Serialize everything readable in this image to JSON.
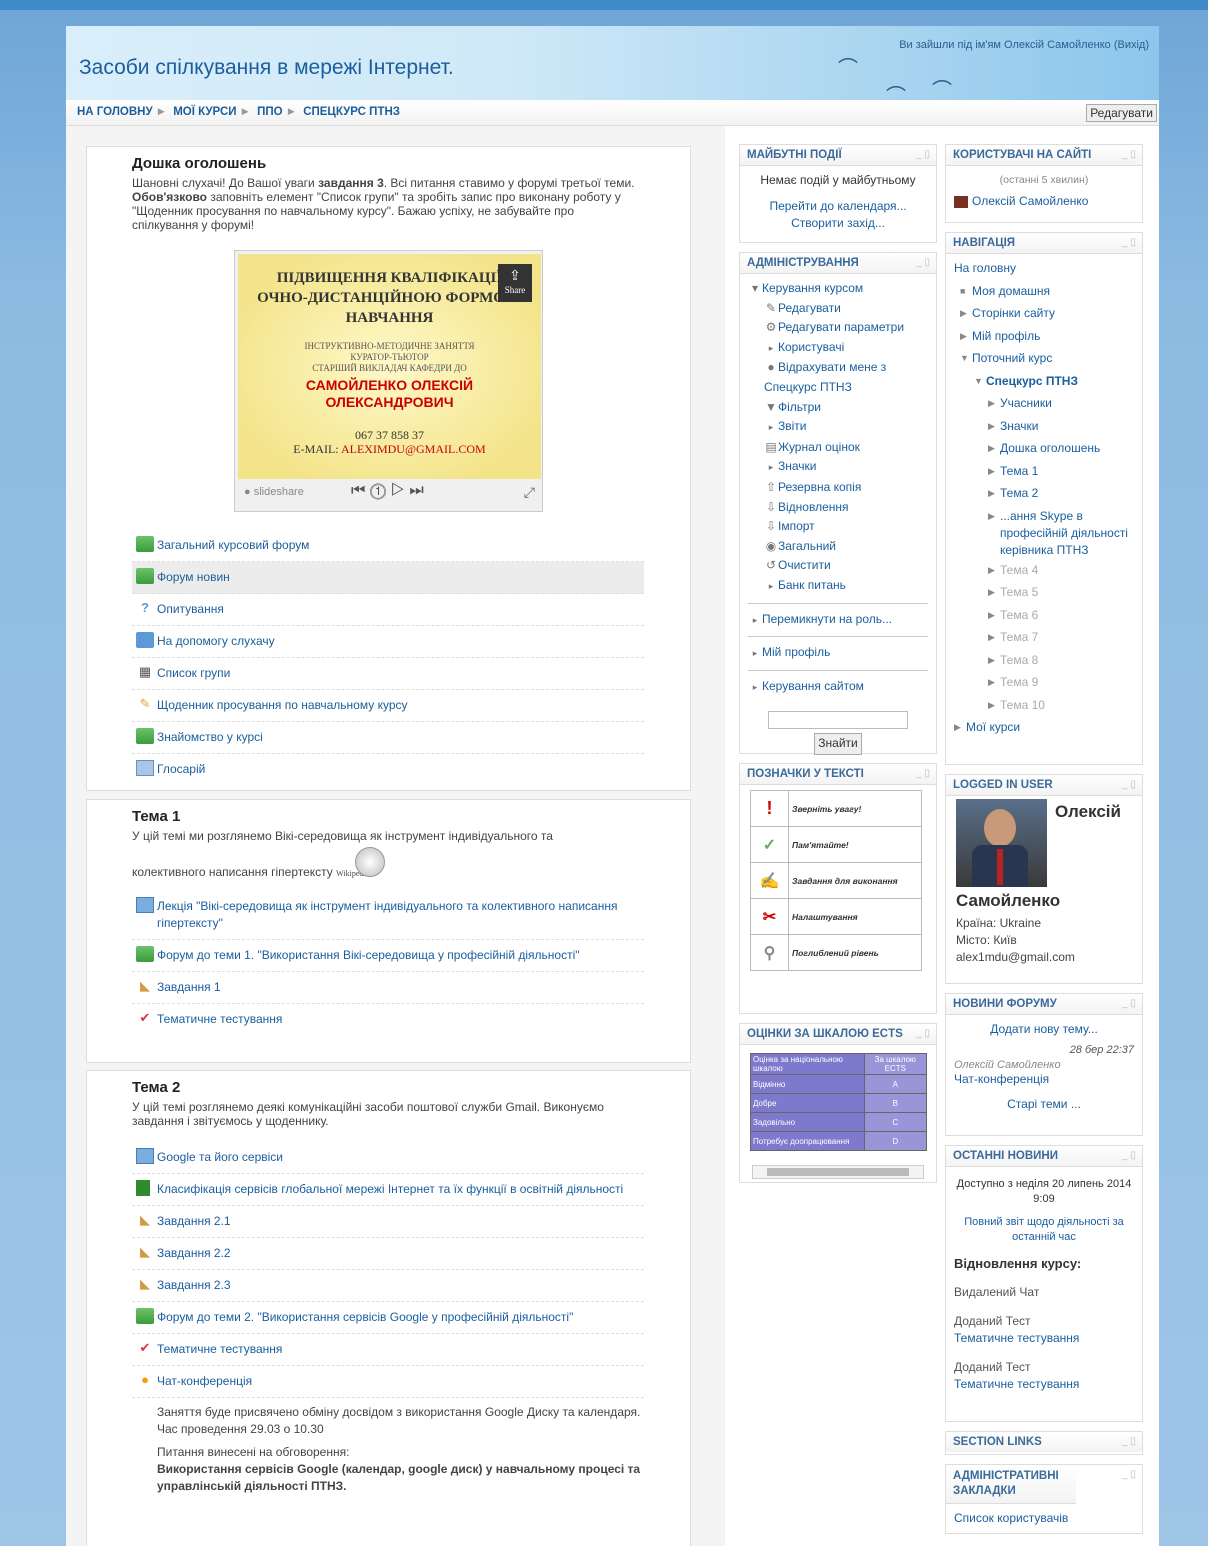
{
  "header": {
    "title": "Засоби спілкування в мережі Інтернет.",
    "login_text": "Ви зайшли під ім'ям Олексій Самойленко (Вихід)"
  },
  "breadcrumb": [
    "НА ГОЛОВНУ",
    "МОЇ КУРСИ",
    "ППО",
    "СПЕЦКУРС ПТНЗ"
  ],
  "edit_button": "Редагувати",
  "section0": {
    "title": "Дошка оголошень",
    "summary_parts": [
      "Шановні слухачі! До Вашої уваги ",
      "завдання 3",
      ". Всі питання ставимо у форумі третьої теми. ",
      "Обов'язково",
      " заповніть елемент \"Список групи\" та зробіть запис про виконану роботу у \"Щоденник просування по навчальному курсу\". Бажаю успіху, не забувайте про спілкування у форумі!"
    ],
    "slide": {
      "line1": "ПІДВИЩЕННЯ КВАЛІФІКАЦІЇ",
      "line1b": "ОЧНО-ДИСТАНЦІЙНОЮ ФОРМОЮ",
      "line1c": "НАВЧАННЯ",
      "line2": "ІНСТРУКТИВНО-МЕТОДИЧНЕ ЗАНЯТТЯ",
      "line2b": "КУРАТОР-ТЬЮТОР",
      "line2c": "СТАРШИЙ ВИКЛАДАЧ КАФЕДРИ ДО",
      "name1": "САМОЙЛЕНКО ОЛЕКСІЙ",
      "name2": "ОЛЕКСАНДРОВИЧ",
      "phone": "067 37 858 37",
      "email_label": "E-MAIL:",
      "email": "ALEXIMDU@GMAIL.COM",
      "share": "Share",
      "brand": "slideshare"
    },
    "activities": [
      "Загальний курсовий форум",
      "Форум новин",
      "Опитування",
      "На допомогу слухачу",
      "Список групи",
      "Щоденник просування по навчальному курсу",
      "Знайомство у курсі",
      "Глосарій"
    ]
  },
  "section1": {
    "title": "Тема 1",
    "summary1": "У цій темі ми розглянемо Вікі-середовища як інструмент індивідуального та",
    "summary2": "колективного написання гіпертексту",
    "wiki": "WikipediA",
    "activities": [
      "Лекція \"Вікі-середовища як інструмент індивідуального та колективного написання гіпертексту\"",
      "Форум до теми 1. \"Використання Вікі-середовища у професійній діяльності\"",
      "Завдання 1",
      "Тематичне тестування"
    ]
  },
  "section2": {
    "title": "Тема 2",
    "summary": "У цій темі розглянемо деякі комунікаційні засоби поштової служби Gmail. Виконуємо завдання і звітуємось у щоденнику.",
    "activities": [
      "Google та його сервіси",
      "Класифікація сервісів глобальної мережі Інтернет та їх функції в освітній діяльності",
      "Завдання 2.1",
      "Завдання 2.2",
      "Завдання 2.3",
      "Форум до теми 2. \"Використання сервісів Google у професійній діяльності\"",
      "Тематичне тестування",
      "Чат-конференція"
    ],
    "note1": "Заняття буде присвячено обміну досвідом з використання Google Диску та календаря.",
    "note2": "Час проведення 29.03 о 10.30",
    "note3": "Питання винесені на обговорення:",
    "note4": "Використання сервісів Google (календар, google диск) у навчальному процесі та управлінській діяльності ПТНЗ."
  },
  "upcoming": {
    "title": "МАЙБУТНІ ПОДІЇ",
    "empty": "Немає подій у майбутньому",
    "link1": "Перейти до календаря...",
    "link2": "Створити захід..."
  },
  "admin": {
    "title": "АДМІНІСТРУВАННЯ",
    "root": "Керування курсом",
    "items": [
      "Редагувати",
      "Редагувати параметри",
      "Користувачі",
      "Відрахувати мене з Спецкурс ПТНЗ",
      "Фільтри",
      "Звіти",
      "Журнал оцінок",
      "Значки",
      "Резервна копія",
      "Відновлення",
      "Імпорт",
      "Загальний",
      "Очистити",
      "Банк питань"
    ],
    "switch_role": "Перемикнути на роль...",
    "profile": "Мій профіль",
    "site_admin": "Керування сайтом",
    "search_button": "Знайти"
  },
  "tags": {
    "title": "ПОЗНАЧКИ У ТЕКСТІ",
    "items": [
      "Зверніть увагу!",
      "Пам'ятайте!",
      "Завдання для виконання",
      "Налаштування",
      "Поглиблений рівень"
    ]
  },
  "ects": {
    "title": "ОЦІНКИ ЗА ШКАЛОЮ ECTS",
    "headers": [
      "Оцінка за національною шкалою",
      "За шкалою ECTS"
    ],
    "rows": [
      [
        "Відмінно",
        "A"
      ],
      [
        "Добре",
        "B"
      ],
      [
        "Задовільно",
        "C"
      ],
      [
        "Потребує доопрацювання",
        "D"
      ]
    ]
  },
  "online": {
    "title": "КОРИСТУВАЧІ НА САЙТІ",
    "note": "(останні 5 хвилин)",
    "user": "Олексій Самойленко"
  },
  "nav": {
    "title": "НАВІГАЦІЯ",
    "home": "На головну",
    "my_home": "Моя домашня",
    "site_pages": "Сторінки сайту",
    "my_profile": "Мій профіль",
    "current": "Поточний курс",
    "course": "Спецкурс ПТНЗ",
    "items": [
      "Учасники",
      "Значки",
      "Дошка оголошень",
      "Тема 1",
      "Тема 2",
      "...ання Skype в професійній діяльності керівника ПТНЗ"
    ],
    "dim_items": [
      "Тема 4",
      "Тема 5",
      "Тема 6",
      "Тема 7",
      "Тема 8",
      "Тема 9",
      "Тема 10"
    ],
    "my_courses": "Мої курси"
  },
  "logged": {
    "title": "LOGGED IN USER",
    "first": "Олексій",
    "last": "Самойленко",
    "country": "Країна: Ukraine",
    "city": "Місто: Київ",
    "email": "alex1mdu@gmail.com"
  },
  "forum_news": {
    "title": "НОВИНИ ФОРУМУ",
    "add": "Додати нову тему...",
    "date": "28 бер 22:37",
    "author": "Олексій Самойленко",
    "post": "Чат-конференція",
    "old": "Старі теми ..."
  },
  "recent": {
    "title": "ОСТАННІ НОВИНИ",
    "since": "Доступно з неділя 20 липень 2014 9:09",
    "report": "Повний звіт щодо діяльності за останній час",
    "restore": "Відновлення курсу:",
    "items": [
      "Видалений Чат",
      "Доданий Тест",
      "Тематичне тестування",
      "Доданий Тест",
      "Тематичне тестування"
    ]
  },
  "section_links": {
    "title": "SECTION LINKS"
  },
  "admin_bookmarks": {
    "title": "АДМІНІСТРАТИВНІ ЗАКЛАДКИ",
    "link": "Список користувачів"
  }
}
